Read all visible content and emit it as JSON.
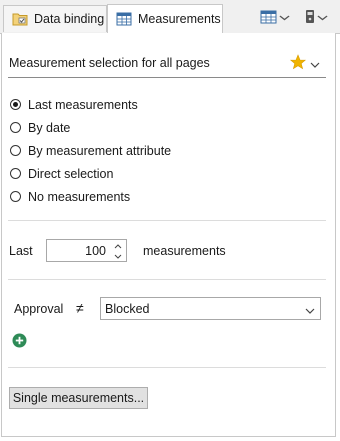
{
  "tabs": [
    {
      "label": "Data binding",
      "icon": "data-binding-icon",
      "active": false
    },
    {
      "label": "Measurements",
      "icon": "table-icon",
      "active": true
    }
  ],
  "toolbar": {
    "layout_icon": "table-layout-icon",
    "device_icon": "device-icon",
    "chevron_icon": "chevron-down-icon"
  },
  "section": {
    "title": "Measurement selection for all pages",
    "favorite_icon": "star-icon",
    "accent_color": "#f0b400"
  },
  "selection_modes": [
    {
      "label": "Last measurements",
      "checked": true
    },
    {
      "label": "By date",
      "checked": false
    },
    {
      "label": "By measurement attribute",
      "checked": false
    },
    {
      "label": "Direct selection",
      "checked": false
    },
    {
      "label": "No measurements",
      "checked": false
    }
  ],
  "last_count": {
    "prefix": "Last",
    "value": "100",
    "suffix": "measurements"
  },
  "filter": {
    "attribute": "Approval",
    "operator": "≠",
    "value": "Blocked",
    "add_icon": "add-circle-icon",
    "add_color": "#2e8b57"
  },
  "single_button": {
    "label": "Single measurements..."
  }
}
